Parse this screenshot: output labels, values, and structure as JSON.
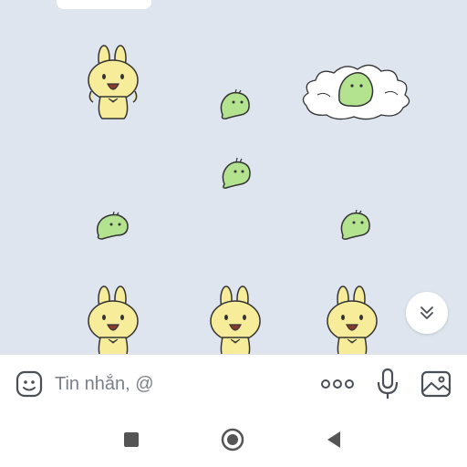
{
  "chat": {
    "stickers": [
      {
        "kind": "bunny"
      },
      {
        "kind": "blob-small"
      },
      {
        "kind": "blob-cloud"
      },
      {
        "kind": "blob-small"
      },
      {
        "kind": "blob-small"
      },
      {
        "kind": "blob-small"
      },
      {
        "kind": "bunny"
      },
      {
        "kind": "bunny"
      },
      {
        "kind": "bunny"
      }
    ],
    "scroll_down_icon": "double-chevron-down-icon"
  },
  "composer": {
    "placeholder": "Tin nhắn, @",
    "value": "",
    "emoji_icon": "sticker-face-icon",
    "more_icon": "more-dots-icon",
    "mic_icon": "microphone-icon",
    "image_icon": "image-icon"
  },
  "nav": {
    "recents_icon": "square-icon",
    "home_icon": "circle-icon",
    "back_icon": "triangle-back-icon"
  },
  "colors": {
    "chat_bg": "#dfe5ee",
    "bunny": "#f6ec9a",
    "blob": "#b3e38f",
    "outline": "#333333",
    "icon": "#4a4f57"
  }
}
